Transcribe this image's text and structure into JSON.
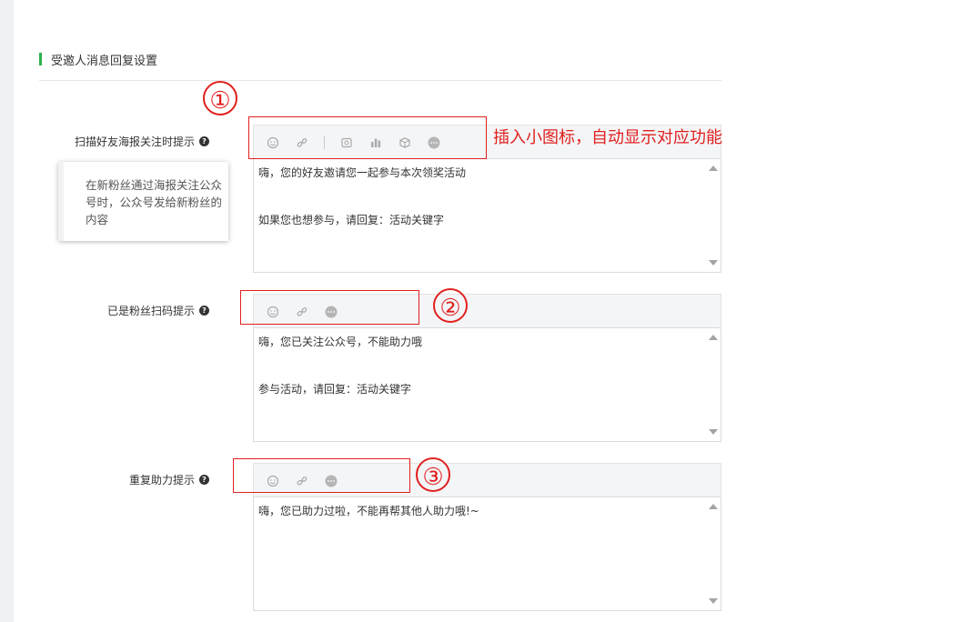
{
  "section": {
    "title": "受邀人消息回复设置"
  },
  "rows": [
    {
      "label": "扫描好友海报关注时提示",
      "help": "?",
      "toolbar_icons": [
        "emoji-icon",
        "link-icon",
        "image-icon",
        "chart-icon",
        "box-icon",
        "more-icon"
      ],
      "content": [
        "嗨，您的好友邀请您一起参与本次领奖活动",
        "如果您也想参与，请回复：活动关键字"
      ]
    },
    {
      "label": "已是粉丝扫码提示",
      "help": "?",
      "toolbar_icons": [
        "emoji-icon",
        "link-icon",
        "more-icon"
      ],
      "content": [
        "嗨，您已关注公众号，不能助力哦",
        "参与活动，请回复：活动关键字"
      ]
    },
    {
      "label": "重复助力提示",
      "help": "?",
      "toolbar_icons": [
        "emoji-icon",
        "link-icon",
        "more-icon"
      ],
      "content": [
        "嗨，您已助力过啦，不能再帮其他人助力哦!~"
      ]
    }
  ],
  "tooltip": {
    "text": "在新粉丝通过海报关注公众号时，公众号发给新粉丝的内容"
  },
  "annotations": {
    "numbers": [
      "①",
      "②",
      "③"
    ],
    "note": "插入小图标，自动显示对应功能",
    "color": "#e0201e"
  },
  "accent_color": "#2bb24c"
}
